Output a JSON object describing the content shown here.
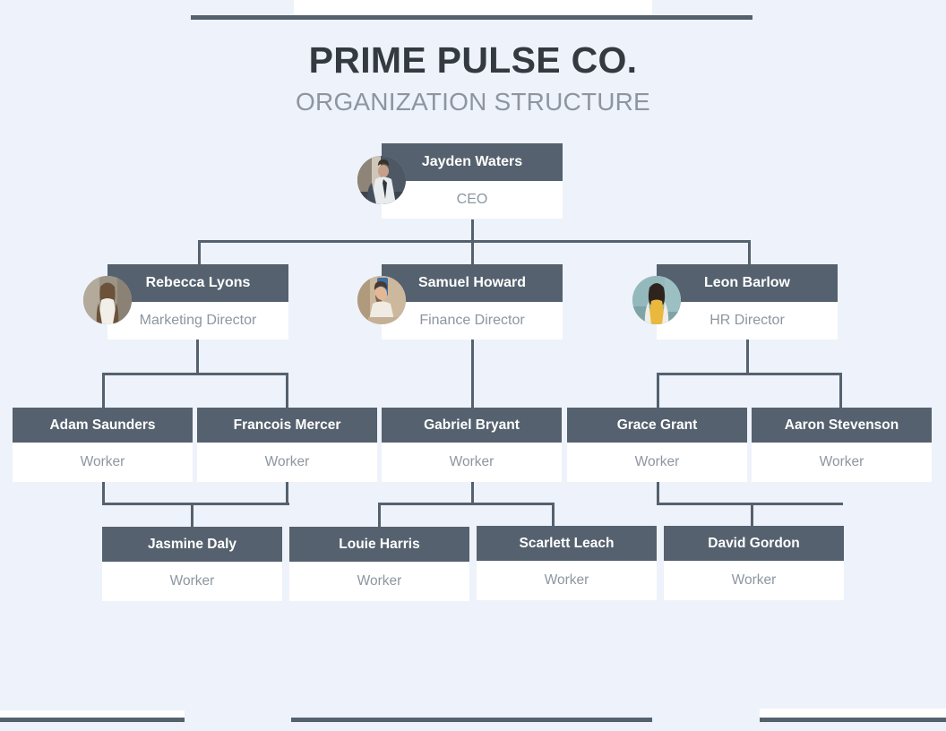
{
  "header": {
    "title": "PRIME PULSE CO.",
    "subtitle": "ORGANIZATION STRUCTURE"
  },
  "theme": {
    "background": "#eef2fa",
    "header_bar": "#55616e",
    "node_header_bg": "#55616e",
    "node_header_text": "#ffffff",
    "node_body_bg": "#ffffff",
    "node_body_text": "#8d96a0",
    "title_color": "#333a40",
    "subtitle_color": "#8d96a0",
    "connector_color": "#55616e"
  },
  "chart_data": {
    "type": "diagram",
    "diagram_type": "org-chart",
    "title": "PRIME PULSE CO.",
    "subtitle": "ORGANIZATION STRUCTURE",
    "levels": 4,
    "nodes": [
      {
        "id": "n1",
        "name": "Jayden Waters",
        "role": "CEO",
        "level": 1,
        "parent": null,
        "avatar": "photo-man-suit"
      },
      {
        "id": "n2",
        "name": "Rebecca Lyons",
        "role": "Marketing Director",
        "level": 2,
        "parent": "n1",
        "avatar": "photo-woman-long-hair"
      },
      {
        "id": "n3",
        "name": "Samuel Howard",
        "role": "Finance Director",
        "level": 2,
        "parent": "n1",
        "avatar": "photo-man-phone"
      },
      {
        "id": "n4",
        "name": "Leon Barlow",
        "role": "HR Director",
        "level": 2,
        "parent": "n1",
        "avatar": "photo-woman-yellow"
      },
      {
        "id": "n5",
        "name": "Adam Saunders",
        "role": "Worker",
        "level": 3,
        "parent": "n2",
        "avatar": null
      },
      {
        "id": "n6",
        "name": "Francois Mercer",
        "role": "Worker",
        "level": 3,
        "parent": "n2",
        "avatar": null
      },
      {
        "id": "n7",
        "name": "Gabriel Bryant",
        "role": "Worker",
        "level": 3,
        "parent": "n3",
        "avatar": null
      },
      {
        "id": "n8",
        "name": "Grace Grant",
        "role": "Worker",
        "level": 3,
        "parent": "n4",
        "avatar": null
      },
      {
        "id": "n9",
        "name": "Aaron Stevenson",
        "role": "Worker",
        "level": 3,
        "parent": "n4",
        "avatar": null
      },
      {
        "id": "n10",
        "name": "Jasmine Daly",
        "role": "Worker",
        "level": 4,
        "parent": "n5",
        "avatar": null
      },
      {
        "id": "n11",
        "name": "Louie Harris",
        "role": "Worker",
        "level": 4,
        "parent": "n6",
        "avatar": null
      },
      {
        "id": "n12",
        "name": "Scarlett Leach",
        "role": "Worker",
        "level": 4,
        "parent": "n7",
        "avatar": null
      },
      {
        "id": "n13",
        "name": "David Gordon",
        "role": "Worker",
        "level": 4,
        "parent": "n8",
        "avatar": null
      }
    ]
  },
  "nodes": {
    "ceo": {
      "name": "Jayden Waters",
      "role": "CEO"
    },
    "marketing": {
      "name": "Rebecca Lyons",
      "role": "Marketing Director"
    },
    "finance": {
      "name": "Samuel Howard",
      "role": "Finance Director"
    },
    "hr": {
      "name": "Leon Barlow",
      "role": "HR Director"
    },
    "w_adam": {
      "name": "Adam Saunders",
      "role": "Worker"
    },
    "w_francois": {
      "name": "Francois Mercer",
      "role": "Worker"
    },
    "w_gabriel": {
      "name": "Gabriel Bryant",
      "role": "Worker"
    },
    "w_grace": {
      "name": "Grace Grant",
      "role": "Worker"
    },
    "w_aaron": {
      "name": "Aaron Stevenson",
      "role": "Worker"
    },
    "w_jasmine": {
      "name": "Jasmine Daly",
      "role": "Worker"
    },
    "w_louie": {
      "name": "Louie Harris",
      "role": "Worker"
    },
    "w_scarlett": {
      "name": "Scarlett Leach",
      "role": "Worker"
    },
    "w_david": {
      "name": "David Gordon",
      "role": "Worker"
    }
  }
}
